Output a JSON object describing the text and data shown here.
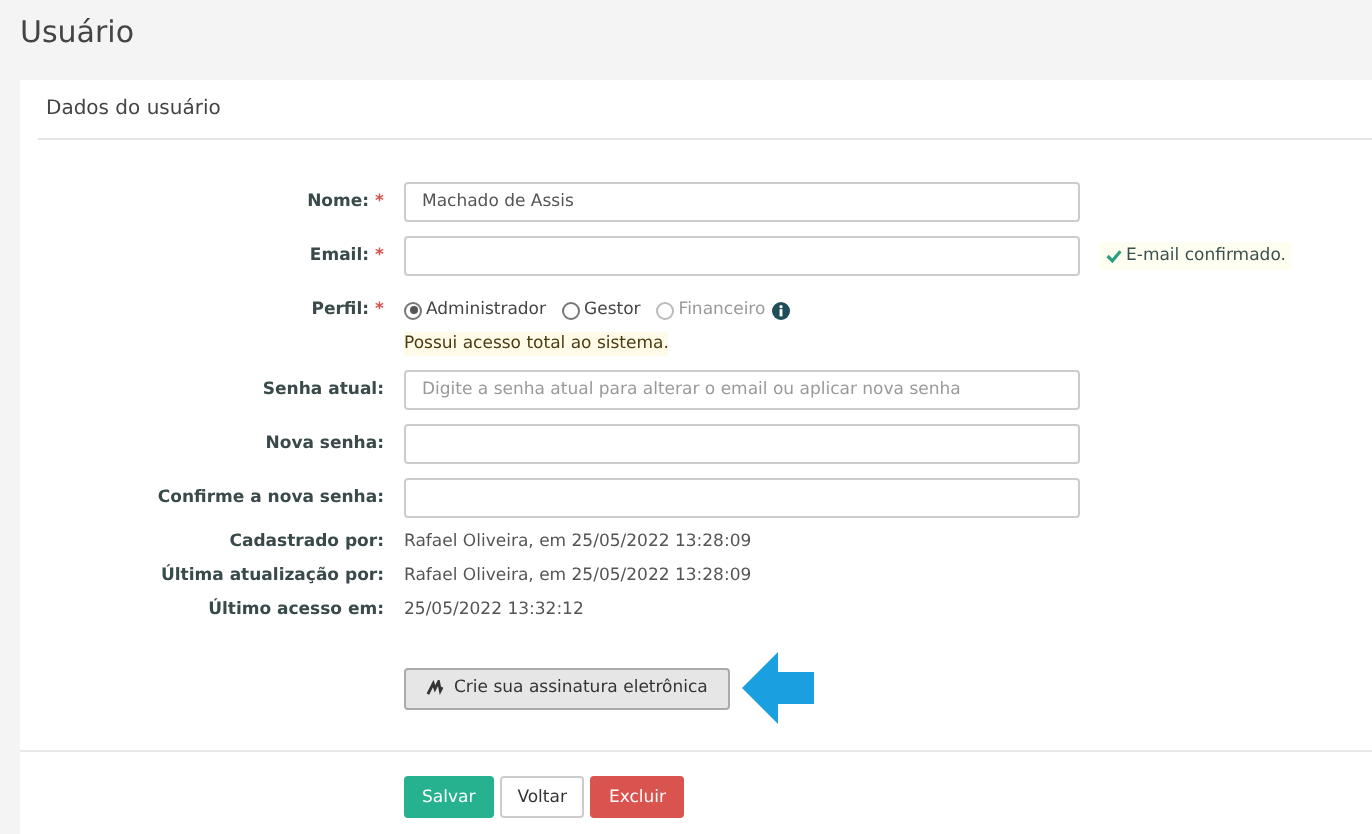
{
  "page_title": "Usuário",
  "panel": {
    "title": "Dados do usuário"
  },
  "rows": [
    {
      "kind": "input",
      "label": "Nome:",
      "required_mark": "*",
      "value": "Machado de Assis"
    },
    {
      "kind": "input",
      "label": "Email:",
      "required_mark": "*",
      "value": "",
      "status": "E-mail confirmado."
    },
    {
      "kind": "radio",
      "label": "Perfil:",
      "required_mark": "*",
      "options": [
        {
          "label": "Administrador",
          "selected": true,
          "disabled": false
        },
        {
          "label": "Gestor",
          "selected": false,
          "disabled": false
        },
        {
          "label": "Financeiro",
          "selected": false,
          "disabled": true
        }
      ],
      "hint": "Possui acesso total ao sistema."
    },
    {
      "kind": "input",
      "label": "Senha atual:",
      "placeholder": "Digite a senha atual para alterar o email ou aplicar nova senha"
    },
    {
      "kind": "input",
      "label": "Nova senha:",
      "value": ""
    },
    {
      "kind": "input",
      "label": "Confirme a nova senha:",
      "value": ""
    },
    {
      "kind": "info",
      "label": "Cadastrado por:",
      "value": "Rafael Oliveira, em 25/05/2022 13:28:09"
    },
    {
      "kind": "info",
      "label": "Última atualização por:",
      "value": "Rafael Oliveira, em 25/05/2022 13:28:09"
    },
    {
      "kind": "info",
      "label": "Último acesso em:",
      "value": "25/05/2022 13:32:12"
    }
  ],
  "signature_button": "Crie sua assinatura eletrônica",
  "actions": [
    {
      "kind": "save",
      "label": "Salvar"
    },
    {
      "kind": "back",
      "label": "Voltar"
    },
    {
      "kind": "delete",
      "label": "Excluir"
    }
  ]
}
